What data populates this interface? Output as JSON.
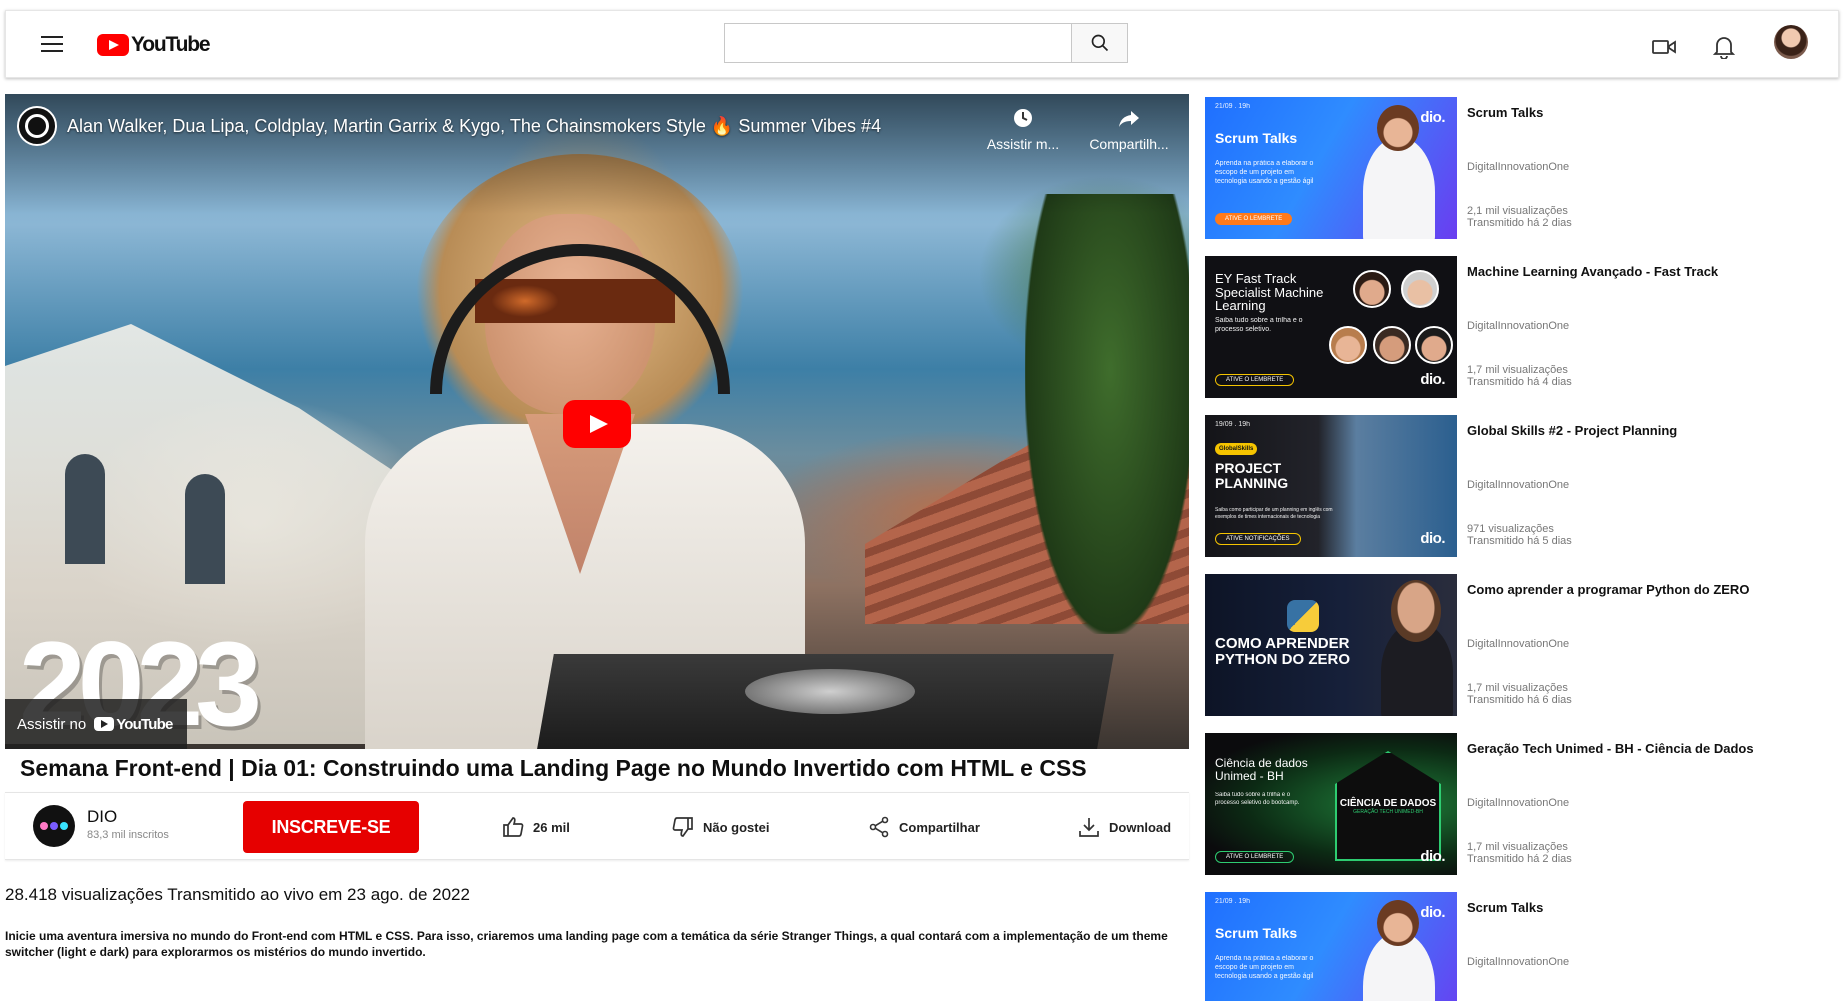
{
  "header": {
    "logo_text": "YouTube",
    "search": {
      "value": "",
      "placeholder": ""
    }
  },
  "player": {
    "title": "Alan Walker, Dua Lipa, Coldplay, Martin Garrix & Kygo, The Chainsmokers Style 🔥 Summer Vibes #4",
    "watch_later_label": "Assistir m...",
    "share_label": "Compartilh...",
    "overlay_year": "2023",
    "watch_on_label": "Assistir no",
    "watch_on_brand": "YouTube"
  },
  "video": {
    "title": "Semana Front-end | Dia 01: Construindo uma Landing Page no Mundo Invertido com HTML e CSS",
    "channel": {
      "name": "DIO",
      "subscribers": "83,3 mil inscritos"
    },
    "subscribe_label": "INSCREVE-SE",
    "likes": "26 mil",
    "dislike_label": "Não gostei",
    "share_label": "Compartilhar",
    "download_label": "Download",
    "stats": "28.418 visualizações Transmitido ao vivo em 23 ago. de 2022",
    "description": "Inicie uma aventura imersiva no mundo do Front-end com HTML e CSS. Para isso, criaremos uma landing page com a temática da série Stranger Things, a qual contará com a implementação de um theme switcher (light e dark) para explorarmos os mistérios do mundo invertido."
  },
  "recommendations": [
    {
      "title": "Scrum Talks",
      "channel": "DigitalInnovationOne",
      "views": "2,1 mil visualizações",
      "age": "Transmitido há 2 dias",
      "thumb": {
        "date": "21/09 . 19h",
        "heading": "Scrum Talks",
        "sub": "Aprenda na prática a elaborar o escopo de um projeto em tecnologia usando a gestão ágil",
        "button": "ATIVE O LEMBRETE",
        "brand": "dio."
      }
    },
    {
      "title": "Machine Learning Avançado - Fast Track",
      "channel": "DigitalInnovationOne",
      "views": "1,7 mil visualizações",
      "age": "Transmitido há 4 dias",
      "thumb": {
        "heading": "EY Fast Track Specialist Machine Learning",
        "sub": "Saiba tudo sobre a trilha e o processo seletivo.",
        "button": "ATIVE O LEMBRETE",
        "brand": "dio."
      }
    },
    {
      "title": "Global Skills #2 - Project Planning",
      "channel": "DigitalInnovationOne",
      "views": "971 visualizações",
      "age": "Transmitido há 5 dias",
      "thumb": {
        "date": "19/09 . 19h",
        "tag": "GlobalSkills",
        "heading": "PROJECT PLANNING",
        "sub": "Saiba como participar de um planning em inglês com exemplos de times internacionais de tecnologia",
        "button": "ATIVE NOTIFICAÇÕES",
        "brand": "dio."
      }
    },
    {
      "title": "Como aprender a programar Python do ZERO",
      "channel": "DigitalInnovationOne",
      "views": "1,7 mil visualizações",
      "age": "Transmitido há 6 dias",
      "thumb": {
        "heading": "COMO APRENDER PYTHON DO ZERO"
      }
    },
    {
      "title": "Geração Tech Unimed - BH - Ciência de Dados",
      "channel": "DigitalInnovationOne",
      "views": "1,7 mil visualizações",
      "age": "Transmitido há 2 dias",
      "thumb": {
        "heading": "Ciência de dados Unimed - BH",
        "sub": "Saiba tudo sobre a trilha e o processo seletivo do bootcamp.",
        "badge": "CIÊNCIA DE DADOS",
        "badge_sub": "GERAÇÃO TECH UNIMED-BH",
        "button": "ATIVE O LEMBRETE",
        "brand": "dio."
      }
    },
    {
      "title": "Scrum Talks",
      "channel": "DigitalInnovationOne",
      "views": "",
      "age": "",
      "thumb": {
        "date": "21/09 . 19h",
        "heading": "Scrum Talks",
        "sub": "Aprenda na prática a elaborar o escopo de um projeto em tecnologia usando a gestão ágil",
        "brand": "dio."
      }
    }
  ]
}
